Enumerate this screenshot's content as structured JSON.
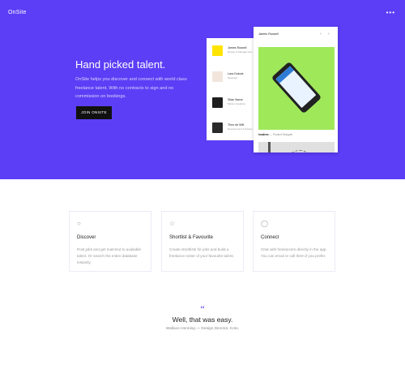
{
  "header": {
    "logo": "OnSite",
    "menu_icon": "more-dots-icon",
    "menu_glyph": "•••"
  },
  "hero": {
    "title": "Hand picked talent.",
    "text": "OnSite helps you discover and connect with world class freelance talent. With no contracts to sign and no commission on bookings.",
    "button_label": "JOIN ONSITE"
  },
  "talent_list": [
    {
      "name": "James Russell",
      "role": "Design & Management"
    },
    {
      "name": "Lara Dubois",
      "role": "Illustrator"
    },
    {
      "name": "Silas Vance",
      "role": "Motion Graphics"
    },
    {
      "name": "Theo de Witt",
      "role": "Development & Design"
    }
  ],
  "detail_card": {
    "header": "James Russell",
    "prev": "‹",
    "next": "›",
    "caption_title": "Incalene",
    "caption_sub": "— Product Designer"
  },
  "features": [
    {
      "icon": "search-icon",
      "glyph": "○",
      "title": "Discover",
      "text": "Post jobs and get matched to available talent. Or search the entire database instantly."
    },
    {
      "icon": "star-icon",
      "glyph": "☆",
      "title": "Shortlist & Favourite",
      "text": "Create shortlists for jobs and build a freelance roster of your favourite talent."
    },
    {
      "icon": "chat-icon",
      "glyph": "◯",
      "title": "Connect",
      "text": "Chat with freelancers directly in the app. You can email or call them if you prefer."
    }
  ],
  "testimonial": {
    "mark": "“",
    "quote": "Well, that was easy.",
    "author": "Wallace Henning — Design Director, Koto."
  },
  "colors": {
    "brand": "#5b3ef5",
    "button": "#111111",
    "phone_bg": "#9fe85a"
  }
}
